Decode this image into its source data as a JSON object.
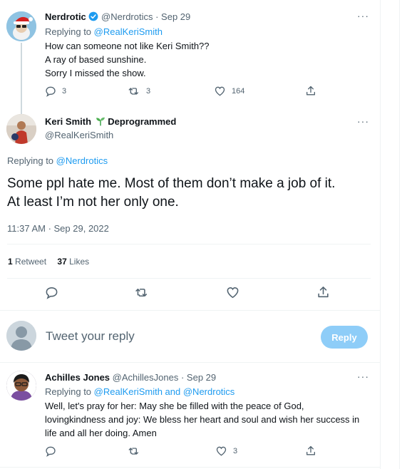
{
  "tweet1": {
    "name": "Nerdrotic",
    "handle": "@Nerdrotics",
    "date": "· Sep 29",
    "replying_prefix": "Replying to ",
    "replying_to": "@RealKeriSmith",
    "text_lines": [
      "How can someone not like Keri Smith??",
      "A ray of based sunshine.",
      "Sorry I missed the show."
    ],
    "replies": "3",
    "retweets": "3",
    "likes": "164"
  },
  "main_tweet": {
    "name": "Keri Smith",
    "badge": "Deprogrammed",
    "handle": "@RealKeriSmith",
    "replying_prefix": "Replying to ",
    "replying_to": "@Nerdrotics",
    "text_lines": [
      "Some ppl hate me. Most of them don’t make a job of it.",
      "At least I’m not her only one."
    ],
    "timestamp": "11:37 AM · Sep 29, 2022",
    "retweet_count": "1",
    "retweet_label": "Retweet",
    "like_count": "37",
    "like_label": "Likes"
  },
  "composer": {
    "placeholder": "Tweet your reply",
    "button_label": "Reply"
  },
  "tweet3": {
    "name": "Achilles Jones",
    "handle": "@AchillesJones",
    "date": "· Sep 29",
    "replying_prefix": "Replying to ",
    "replying_to_1": "@RealKeriSmith",
    "replying_and": " and ",
    "replying_to_2": "@Nerdrotics",
    "text_lines": [
      "Well, let's pray for her: May she be filled with the peace of God,",
      "lovingkindness and joy: We bless her heart and soul and wish her success in",
      "life and  all her doing. Amen"
    ],
    "likes": "3"
  },
  "more_glyph": "···",
  "colors": {
    "accent": "#1d9bf0",
    "muted": "#536471",
    "reply_button": "#8ecdf8",
    "verified": "#1d9bf0",
    "badge_plant": "#2e9e3e"
  },
  "icons": [
    "reply-icon",
    "retweet-icon",
    "like-icon",
    "share-icon",
    "verified-badge-icon",
    "seedling-icon",
    "more-icon",
    "default-avatar-icon"
  ]
}
